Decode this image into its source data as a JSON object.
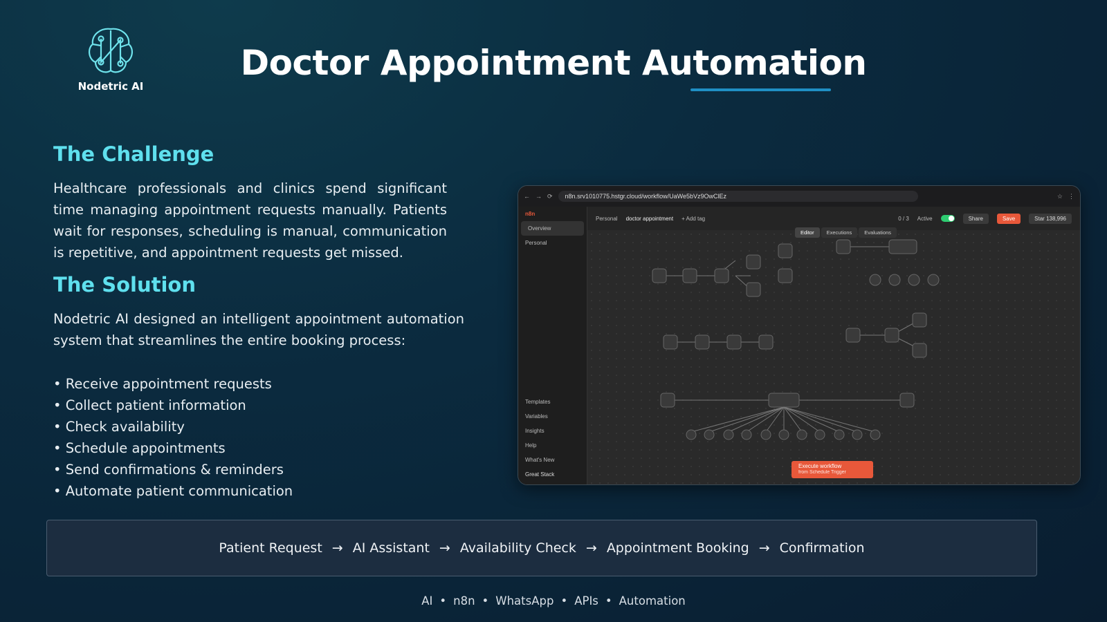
{
  "brand": {
    "name": "Nodetric AI",
    "accent": "#5fe0ee",
    "underline": "#1f8fc4"
  },
  "title": "Doctor Appointment Automation",
  "challenge": {
    "heading": "The Challenge",
    "text": "Healthcare professionals and clinics spend significant time managing appointment requests manually. Patients wait for responses, scheduling is manual, communication is repetitive, and appointment requests get missed."
  },
  "solution": {
    "heading": "The Solution",
    "text": "Nodetric AI designed an intelligent appointment automation system that streamlines the entire booking process:",
    "bullets": [
      "• Receive appointment requests",
      "• Collect patient information",
      "• Check availability",
      "• Schedule appointments",
      "• Send confirmations & reminders",
      "• Automate patient communication"
    ]
  },
  "screenshot": {
    "url": "n8n.srv1010775.hstgr.cloud/workflow/UaWe5bVz9OwClEz",
    "breadcrumb_project": "Personal",
    "workflow_name": "doctor appointment",
    "add_tag": "+ Add tag",
    "counter": "0 / 3",
    "active_label": "Active",
    "share_label": "Share",
    "save_label": "Save",
    "star_label": "Star",
    "star_count": "138,996",
    "tabs": [
      "Editor",
      "Executions",
      "Evaluations"
    ],
    "sidebar_top": [
      "Overview",
      "Personal"
    ],
    "sidebar_bottom": [
      "Templates",
      "Variables",
      "Insights",
      "Help",
      "What's New"
    ],
    "user": "Great Stack",
    "execute_label": "Execute workflow",
    "execute_sub": "from Schedule Trigger"
  },
  "flow": {
    "steps": [
      "Patient Request",
      "AI Assistant",
      "Availability Check",
      "Appointment Booking",
      "Confirmation"
    ],
    "arrow": "→"
  },
  "footer": {
    "items": [
      "AI",
      "n8n",
      "WhatsApp",
      "APIs",
      "Automation"
    ],
    "separator": "•"
  }
}
